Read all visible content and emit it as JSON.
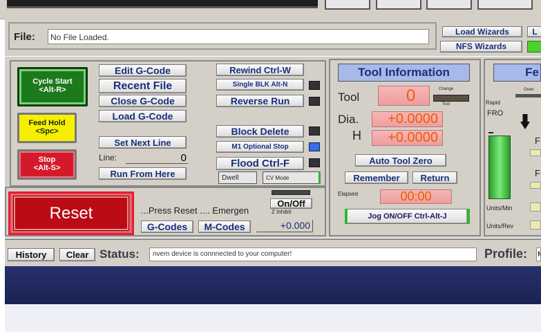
{
  "file": {
    "label": "File:",
    "value": "No File Loaded."
  },
  "wizards": {
    "load": "Load Wizards",
    "nfs": "NFS Wizards",
    "partial": "L"
  },
  "program": {
    "cycle_start": [
      "Cycle Start",
      "<Alt-R>"
    ],
    "feed_hold": [
      "Feed Hold",
      "<Spc>"
    ],
    "stop": [
      "Stop",
      "<Alt-S>"
    ],
    "edit_gcode": "Edit G-Code",
    "recent_file": "Recent File",
    "close_gcode": "Close G-Code",
    "load_gcode": "Load G-Code",
    "set_next_line": "Set Next Line",
    "line_label": "Line:",
    "line_value": "0",
    "run_from_here": "Run From Here",
    "rewind": "Rewind Ctrl-W",
    "single_blk": "Single BLK Alt-N",
    "reverse_run": "Reverse Run",
    "block_delete": "Block Delete",
    "m1_optional_stop": "M1 Optional Stop",
    "flood": "Flood Ctrl-F",
    "dwell": "Dwell",
    "cv_mode": "CV Mode"
  },
  "reset": {
    "label": "Reset",
    "message": "...Press Reset .... Emergen",
    "on_off": "On/Off",
    "z_inhibit": "Z Inhibit",
    "gcodes": "G-Codes",
    "mcodes": "M-Codes",
    "z_value": "+0.000"
  },
  "tool": {
    "title": "Tool Information",
    "tool_label": "Tool",
    "tool_value": "0",
    "change_label": "Change",
    "change_sub": "Tool",
    "dia_label": "Dia.",
    "dia_value": "+0.0000",
    "h_label": "H",
    "h_value": "+0.0000",
    "auto_tool_zero": "Auto Tool Zero",
    "remember": "Remember",
    "return": "Return",
    "elapsed_label": "Elapsed",
    "elapsed_value": "00:00",
    "jog": "Jog ON/OFF Ctrl-Alt-J"
  },
  "feed": {
    "title": "Fe",
    "overr": "Overr",
    "rapid": "Rapid",
    "fro": "FRO",
    "units_min": "Units/Min",
    "units_rev": "Units/Rev",
    "f1": "F",
    "f2": "F"
  },
  "status_bar": {
    "history": "History",
    "clear": "Clear",
    "status_label": "Status:",
    "status_text": "nvem device is connnected to your computer!",
    "profile_label": "Profile:",
    "profile_partial": "M"
  },
  "colors": {
    "panel": "#d4d0c8",
    "title_bar": "#28306c",
    "status_bar": "#eef0f6"
  }
}
